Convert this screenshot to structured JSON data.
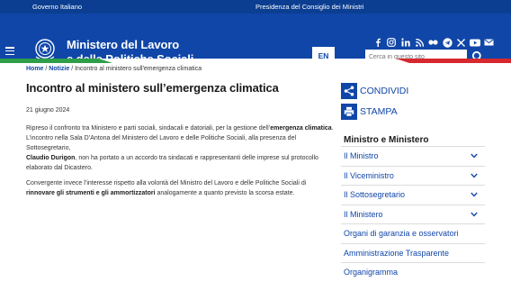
{
  "topbar": {
    "left_link": "Governo Italiano",
    "center_link": "Presidenza del Consiglio dei Ministri"
  },
  "header": {
    "title_line1": "Ministero del Lavoro",
    "title_line2": "e delle Politiche Sociali",
    "lang_button": "EN",
    "search_placeholder": "Cerca in questo sito",
    "social_icons": [
      "facebook-icon",
      "instagram-icon",
      "linkedin-icon",
      "rss-icon",
      "flickr-icon",
      "telegram-icon",
      "x-icon",
      "youtube-icon",
      "mail-icon"
    ]
  },
  "colors": {
    "brand_blue": "#1046a8",
    "topbar_blue": "#0b3e91",
    "flag_green": "#2e9f48",
    "flag_red": "#d6282e"
  },
  "breadcrumb": {
    "home": "Home",
    "section": "Notizie",
    "current": "Incontro al ministero sull'emergenza climatica"
  },
  "article": {
    "title": "Incontro al ministero sull’emergenza climatica",
    "date": "21 giugno 2024",
    "p1_a": "Ripreso il confronto tra Ministero e parti sociali, sindacali e datoriali, per la gestione dell’",
    "p1_b": "emergenza climatica",
    "p1_c": ".",
    "p1_d": "L’incontro nella Sala D’Antona del Ministero del Lavoro e delle Politiche Sociali, alla presenza del Sottosegretario,",
    "p1_e": "Claudio Durigon",
    "p1_f": ", non ha portato a un accordo tra sindacati e rappresentanti delle imprese sul protocollo elaborato dal Dicastero.",
    "p2_a": "Convergente invece l’interesse rispetto alla volontà del Ministro del Lavoro e delle Politiche Sociali di ",
    "p2_b": "rinnovare gli strumenti e gli ammortizzatori",
    "p2_c": " analogamente a quanto previsto la scorsa estate."
  },
  "sidebar": {
    "share_label": "CONDIVIDI",
    "print_label": "STAMPA",
    "section_title": "Ministro e Ministero",
    "items": [
      {
        "label": "Il Ministro"
      },
      {
        "label": "Il Viceministro"
      },
      {
        "label": "Il Sottosegretario"
      },
      {
        "label": "Il Ministero"
      },
      {
        "label": "Organi di garanzia e osservatori"
      },
      {
        "label": "Amministrazione Trasparente"
      },
      {
        "label": "Organigramma"
      }
    ]
  }
}
